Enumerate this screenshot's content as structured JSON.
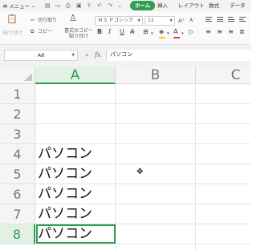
{
  "menubar": {
    "hamburger_icon": "hamburger-icon",
    "menu_label": "メニュー",
    "tabs": [
      "ホーム",
      "挿入",
      "レイアウト",
      "数式",
      "データ"
    ],
    "active_tab": "ホーム",
    "accent_color": "#2e9e50"
  },
  "ribbon": {
    "cut_label": "切り取り",
    "paste_label": "貼り付け",
    "copy_label": "コピー",
    "format_painter_label": "書式のコピー\n貼り付け",
    "font_name": "ＭＳ Ｐゴシック",
    "font_size": "11",
    "bold": "B",
    "italic": "I",
    "underline": "U",
    "font_grow": "A⁺",
    "font_shrink": "A⁻",
    "fill_color": "#f5c518",
    "font_color": "#e53935"
  },
  "formula_bar": {
    "cell_ref": "A8",
    "fx_label": "fx",
    "content": "パソコン"
  },
  "grid": {
    "columns": [
      "A",
      "B",
      "C"
    ],
    "rows": [
      "1",
      "2",
      "3",
      "4",
      "5",
      "6",
      "7",
      "8"
    ],
    "selected_column": "A",
    "selected_row": "8",
    "cells": {
      "A1": "",
      "A2": "",
      "A3": "",
      "A4": "パソコン",
      "A5": "パソコン",
      "A6": "パソコン",
      "A7": "パソコン",
      "A8": "パソコン"
    }
  }
}
